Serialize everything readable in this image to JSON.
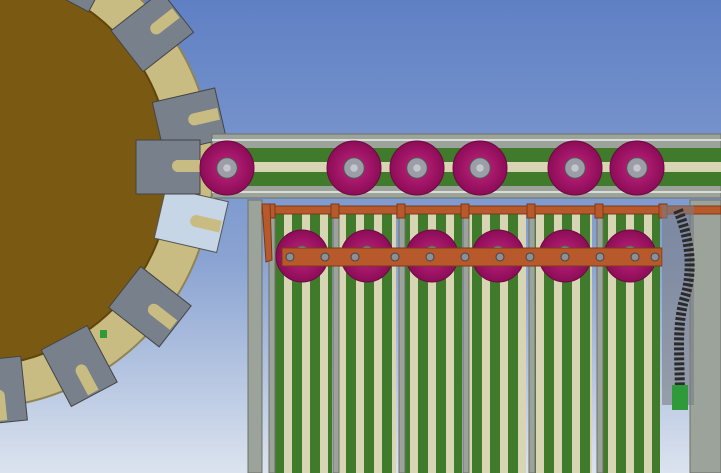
{
  "scene": {
    "description_visible_text": "",
    "colors": {
      "sky_top": "#5f80c4",
      "sky_bottom": "#d9e2ee",
      "turntable": "#7a5a12",
      "turntable_edge": "#5f450a",
      "fixture_ring": "#c9bc82",
      "gripper_block": "#77808b",
      "gripper_block_light": "#c7d6e6",
      "gripper_slot": "#c9bc82",
      "rail_frame": "#9ca39a",
      "rail_green": "#3f7b2a",
      "rail_cream": "#d8d5b4",
      "disc_magenta": "#b1126f",
      "disc_hub": "#9b9ea6",
      "bracket_orange": "#b8592c",
      "green_accent": "#2f9a3a",
      "cable_chain": "#2b2b2b"
    },
    "icons": {
      "top_conveyor_discs": 6,
      "lower_conveyor_discs": 6,
      "vertical_lanes": 6
    }
  }
}
